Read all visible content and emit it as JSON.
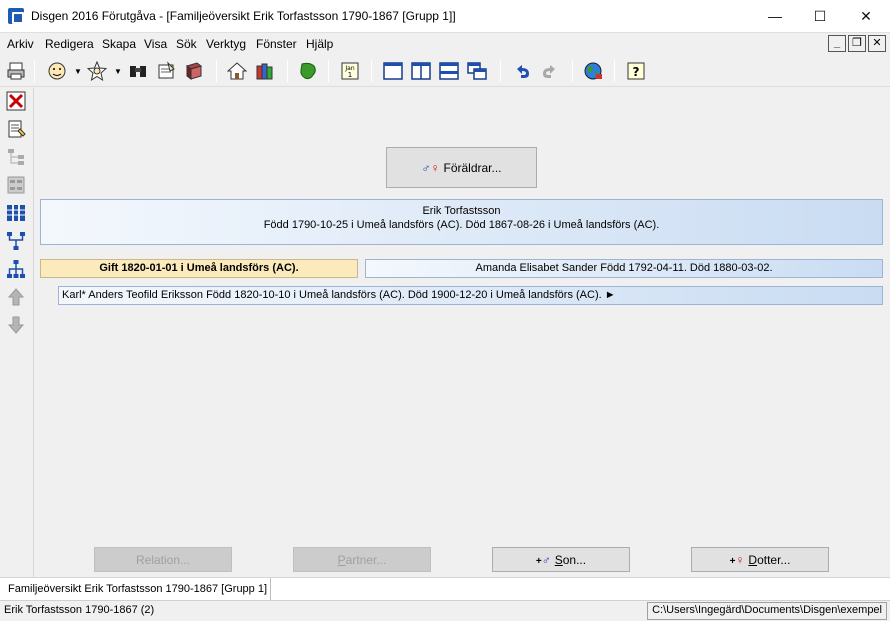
{
  "window": {
    "title": "Disgen 2016 Förutgåva - [Familjeöversikt Erik Torfastsson 1790-1867 [Grupp 1]]",
    "minimize": "—",
    "maximize": "☐",
    "close": "✕"
  },
  "menu": {
    "items": [
      "Arkiv",
      "Redigera",
      "Skapa",
      "Visa",
      "Sök",
      "Verktyg",
      "Fönster",
      "Hjälp"
    ]
  },
  "mdi": {
    "minimize": "_",
    "restore": "❐",
    "close": "✕"
  },
  "family": {
    "parents_button": "Föräldrar...",
    "person_name": "Erik Torfastsson",
    "person_details": "Född 1790-10-25 i Umeå landsförs (AC). Död 1867-08-26 i Umeå landsförs (AC).",
    "marriage": "Gift 1820-01-01 i Umeå landsförs (AC).",
    "partner": "Amanda Elisabet Sander Född 1792-04-11. Död 1880-03-02.",
    "child": "Karl* Anders Teofild Eriksson Född 1820-10-10 i Umeå landsförs (AC). Död 1900-12-20 i Umeå landsförs (AC). ►"
  },
  "bottom_buttons": {
    "relation": "Relation...",
    "partner_pre": "",
    "partner_ul": "P",
    "partner_post": "artner...",
    "son_ul": "S",
    "son_post": "on...",
    "dotter_ul": "D",
    "dotter_post": "otter..."
  },
  "tab": {
    "label": "Familjeöversikt Erik Torfastsson 1790-1867 [Grupp 1]"
  },
  "status": {
    "left": "Erik Torfastsson 1790-1867 (2)",
    "right": "C:\\Users\\Ingegärd\\Documents\\Disgen\\exempel"
  }
}
